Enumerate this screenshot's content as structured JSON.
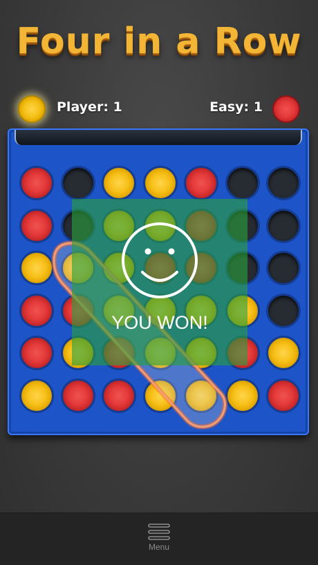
{
  "title": "Four in a Row",
  "scorebar": {
    "player_label": "Player: 1",
    "opponent_label": "Easy: 1",
    "player_color": "#f5c118",
    "opponent_color": "#e53a3a"
  },
  "board": {
    "rows": 6,
    "cols": 7,
    "grid": [
      [
        "red",
        "empty",
        "yellow",
        "yellow",
        "red",
        "empty",
        "empty"
      ],
      [
        "red",
        "empty",
        "yellow",
        "yellow",
        "red",
        "empty",
        "empty"
      ],
      [
        "yellow",
        "yellow",
        "yellow",
        "red",
        "red",
        "empty",
        "empty"
      ],
      [
        "red",
        "red",
        "yellow",
        "yellow",
        "yellow",
        "yellow",
        "empty"
      ],
      [
        "red",
        "yellow",
        "red",
        "yellow",
        "yellow",
        "red",
        "yellow"
      ],
      [
        "yellow",
        "red",
        "red",
        "yellow",
        "yellow",
        "yellow",
        "red"
      ]
    ]
  },
  "result": {
    "message": "YOU WON!",
    "icon": "smiley-icon"
  },
  "menu": {
    "label": "Menu",
    "icon": "menu-icon"
  }
}
